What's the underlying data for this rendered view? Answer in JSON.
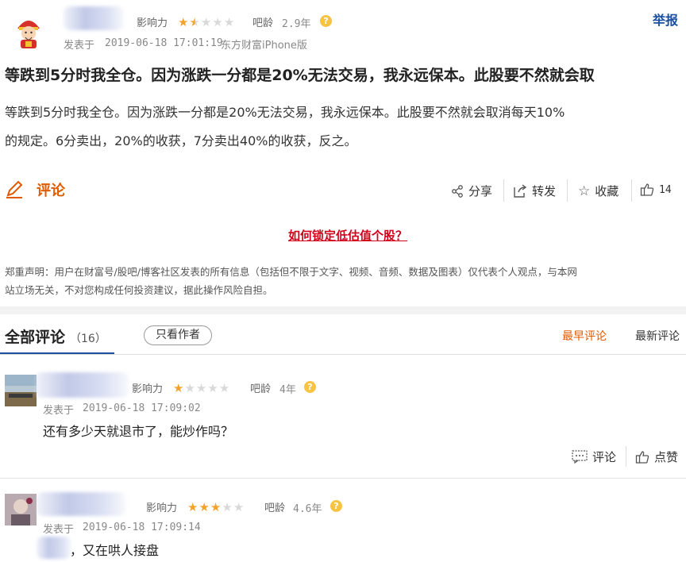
{
  "post": {
    "influence_label": "影响力",
    "influence_stars": 1.5,
    "age_label": "吧龄",
    "age_value": "2.9年",
    "report_label": "举报",
    "published_label": "发表于",
    "published_time": "2019-06-18 17:01:19",
    "source": "东方财富iPhone版",
    "title": "等跌到5分时我全仓。因为涨跌一分都是20%无法交易，我永远保本。此股要不然就会取",
    "body_line1": "等跌到5分时我全仓。因为涨跌一分都是20%无法交易，我永远保本。此股要不然就会取消每天10%",
    "body_line2": "的规定。6分卖出，20%的收获，7分卖出40%的收获，反之。"
  },
  "actions": {
    "comment_label": "评论",
    "share_label": "分享",
    "forward_label": "转发",
    "favorite_label": "收藏",
    "like_count": "14"
  },
  "promo_link": "如何锁定低估值个股？",
  "disclaimer": {
    "line1": "郑重声明：用户在财富号/股吧/博客社区发表的所有信息（包括但不限于文字、视频、音频、数据及图表）仅代表个人观点，与本网",
    "line2": "站立场无关，不对您构成任何投资建议，据此操作风险自担。"
  },
  "comments_header": {
    "all_label": "全部评论",
    "count": "（16）",
    "author_only": "只看作者",
    "earliest": "最早评论",
    "latest": "最新评论"
  },
  "comments": [
    {
      "influence_label": "影响力",
      "stars": 1,
      "age_label": "吧龄",
      "age_value": "4年",
      "published_label": "发表于",
      "published_time": "2019-06-18 17:09:02",
      "text": "还有多少天就退市了，能炒作吗？",
      "reply_label": "评论",
      "like_label": "点赞"
    },
    {
      "influence_label": "影响力",
      "stars": 3,
      "age_label": "吧龄",
      "age_value": "4.6年",
      "published_label": "发表于",
      "published_time": "2019-06-18 17:09:14",
      "text": "，又在哄人接盘"
    }
  ],
  "colors": {
    "accent_orange": "#e05a00",
    "link_red": "#d0021b",
    "star_on": "#f3a32c",
    "report_blue": "#1b4fa0"
  }
}
